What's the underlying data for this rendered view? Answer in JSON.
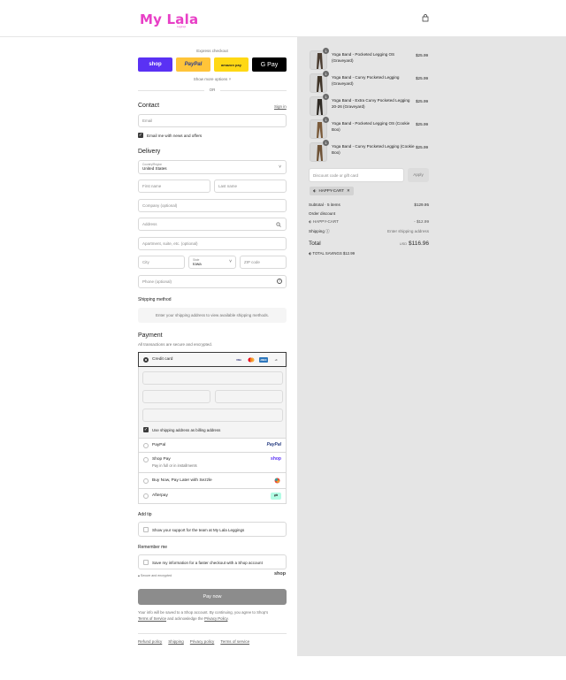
{
  "brand": {
    "logo_text": "My Lala",
    "logo_sub": "Leggings",
    "color": "#e83fc6"
  },
  "express": {
    "title": "Express checkout",
    "buttons": [
      "shop",
      "PayPal",
      "amazon pay",
      "G Pay"
    ],
    "more": "Show more options",
    "or": "OR"
  },
  "contact": {
    "title": "Contact",
    "sign_in": "Sign in",
    "email_placeholder": "Email",
    "newsletter_label": "Email me with news and offers",
    "newsletter_checked": true
  },
  "delivery": {
    "title": "Delivery",
    "country_label": "Country/Region",
    "country_value": "United States",
    "first_name": "First name",
    "last_name": "Last name",
    "company": "Company (optional)",
    "address": "Address",
    "apartment": "Apartment, suite, etc. (optional)",
    "city": "City",
    "state_label": "State",
    "state_value": "Iowa",
    "zip": "ZIP code",
    "phone": "Phone (optional)"
  },
  "shipping_method": {
    "title": "Shipping method",
    "message": "Enter your shipping address to view available shipping methods."
  },
  "payment": {
    "title": "Payment",
    "subtitle": "All transactions are secure and encrypted.",
    "credit_card_label": "Credit card",
    "card_badges": [
      "VISA",
      "MC",
      "AMEX",
      "+3"
    ],
    "billing_label": "Use shipping address as billing address",
    "options": [
      {
        "label": "PayPal",
        "logo": "PayPal",
        "sub": ""
      },
      {
        "label": "Shop Pay",
        "logo": "shop",
        "sub": "Pay in full or in installments"
      },
      {
        "label": "Buy Now, Pay Later with Sezzle",
        "logo": "sezzle",
        "sub": ""
      },
      {
        "label": "Afterpay",
        "logo": "afterpay",
        "sub": ""
      }
    ]
  },
  "tip": {
    "title": "Add tip",
    "label": "Show your support for the team at My Lala Leggings"
  },
  "remember": {
    "title": "Remember me",
    "label": "Save my information for a faster checkout with a Shop account",
    "secure": "Secure and encrypted",
    "shop": "shop"
  },
  "pay_now": "Pay now",
  "legal": {
    "line1": "Your info will be saved to a Shop account. By continuing, you agree to Shop's",
    "terms": "Terms of Service",
    "and": "and acknowledge the",
    "privacy": "Privacy Policy"
  },
  "footer_links": [
    "Refund policy",
    "Shipping",
    "Privacy policy",
    "Terms of service"
  ],
  "order": {
    "items": [
      {
        "qty": "1",
        "title": "Yoga Band - Pocketed Legging OS (Graveyard)",
        "price": "$25.99"
      },
      {
        "qty": "1",
        "title": "Yoga Band - Curvy Pocketed Legging (Graveyard)",
        "price": "$25.99"
      },
      {
        "qty": "1",
        "title": "Yoga Band - Extra Curvy Pocketed Legging 20-26 (Graveyard)",
        "price": "$25.99"
      },
      {
        "qty": "1",
        "title": "Yoga Band - Pocketed Legging OS (Cookie Boo)",
        "price": "$25.99"
      },
      {
        "qty": "1",
        "title": "Yoga Band - Curvy Pocketed Legging (Cookie Boo)",
        "price": "$25.99"
      }
    ],
    "discount_placeholder": "Discount code or gift card",
    "apply": "Apply",
    "tag": "HAPPY-CART",
    "subtotal_label": "Subtotal · 5 items",
    "subtotal": "$129.95",
    "order_discount": "Order discount",
    "discount_code": "HAPPY-CART",
    "discount_amount": "- $12.99",
    "shipping_label": "Shipping",
    "shipping_value": "Enter shipping address",
    "total_label": "Total",
    "currency": "USD",
    "total": "$116.96",
    "savings_label": "TOTAL SAVINGS",
    "savings": "$12.99"
  }
}
